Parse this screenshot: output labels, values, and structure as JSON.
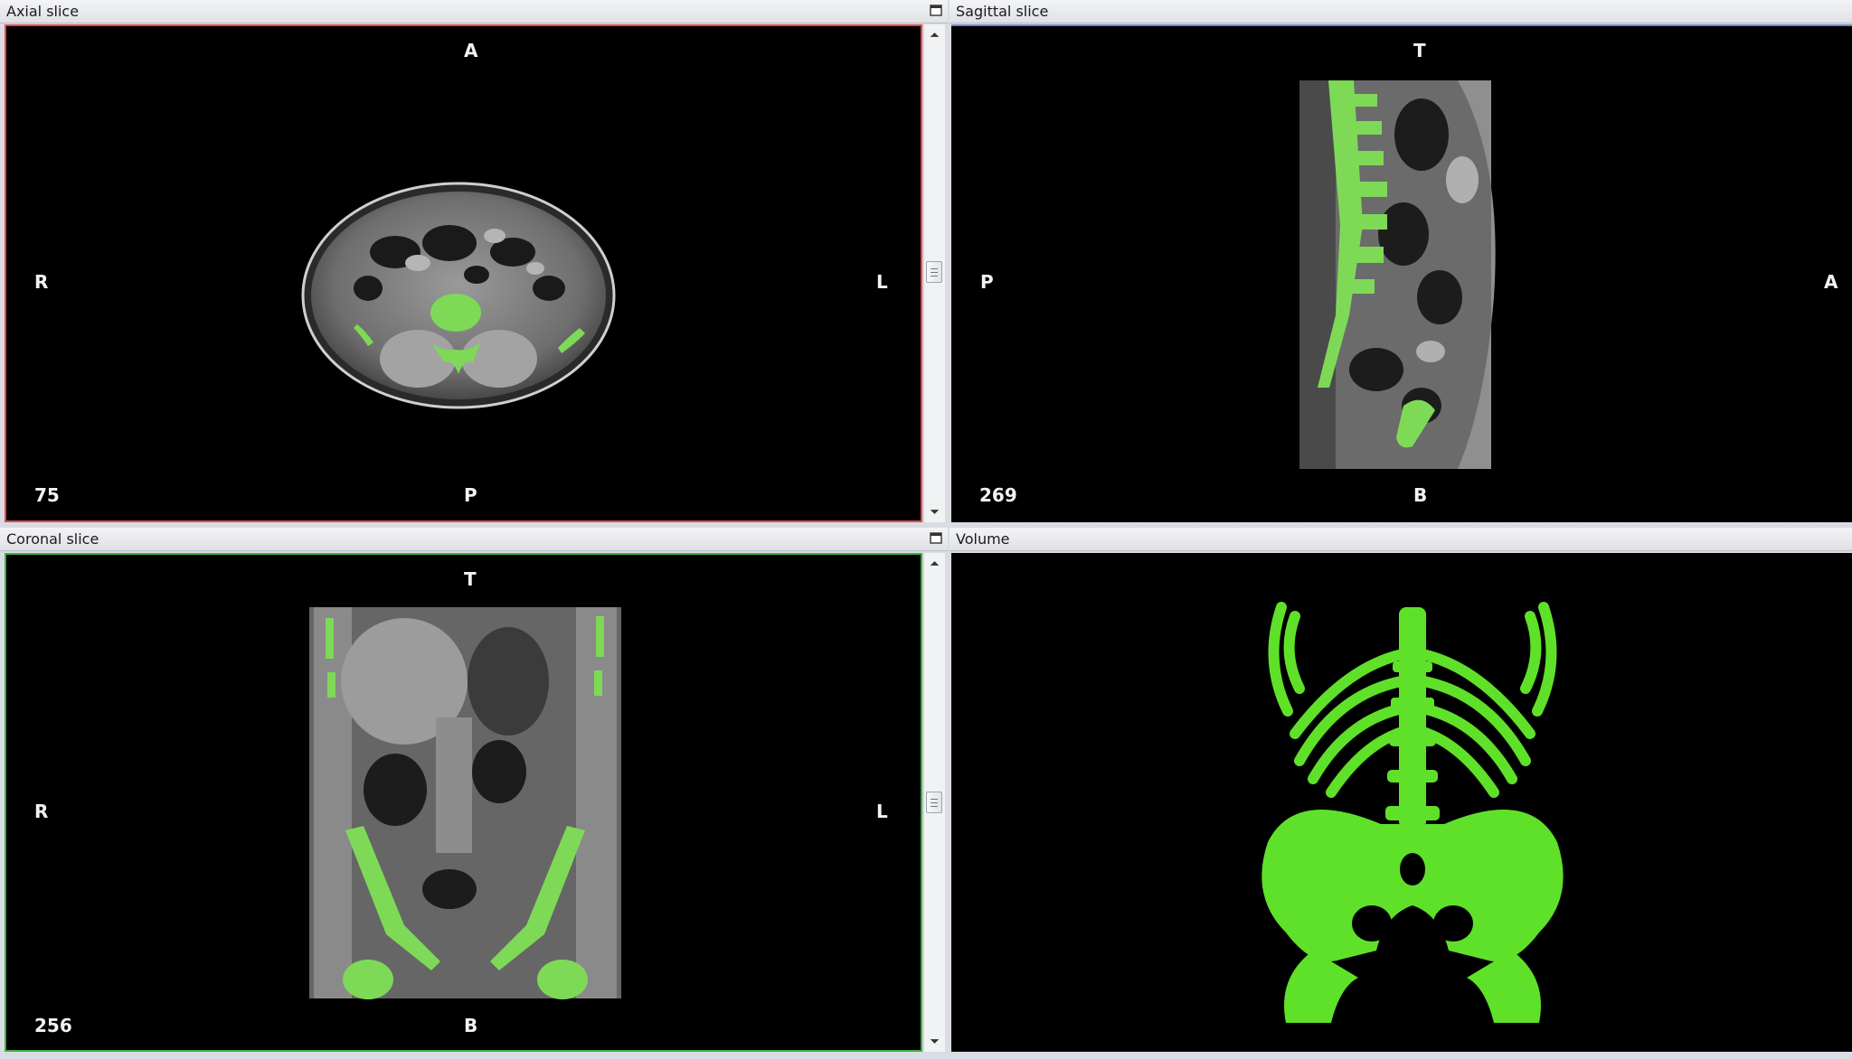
{
  "panels": {
    "axial": {
      "title": "Axial slice",
      "top": "A",
      "bottom": "P",
      "left": "R",
      "right": "L",
      "slice": "75",
      "border_color": "#e04a4a"
    },
    "sagittal": {
      "title": "Sagittal slice",
      "top": "T",
      "bottom": "B",
      "left": "P",
      "right": "A",
      "slice": "269",
      "border_color": "#6f86c8"
    },
    "coronal": {
      "title": "Coronal slice",
      "top": "T",
      "bottom": "B",
      "left": "R",
      "right": "L",
      "slice": "256",
      "border_color": "#3fae3f"
    },
    "volume": {
      "title": "Volume"
    }
  },
  "colors": {
    "segmentation": "#7ed957",
    "render3d": "#5fe12a",
    "background": "#000000"
  },
  "icons": [
    "maximize-icon",
    "scroll-up-arrow-icon",
    "scroll-down-arrow-icon"
  ]
}
